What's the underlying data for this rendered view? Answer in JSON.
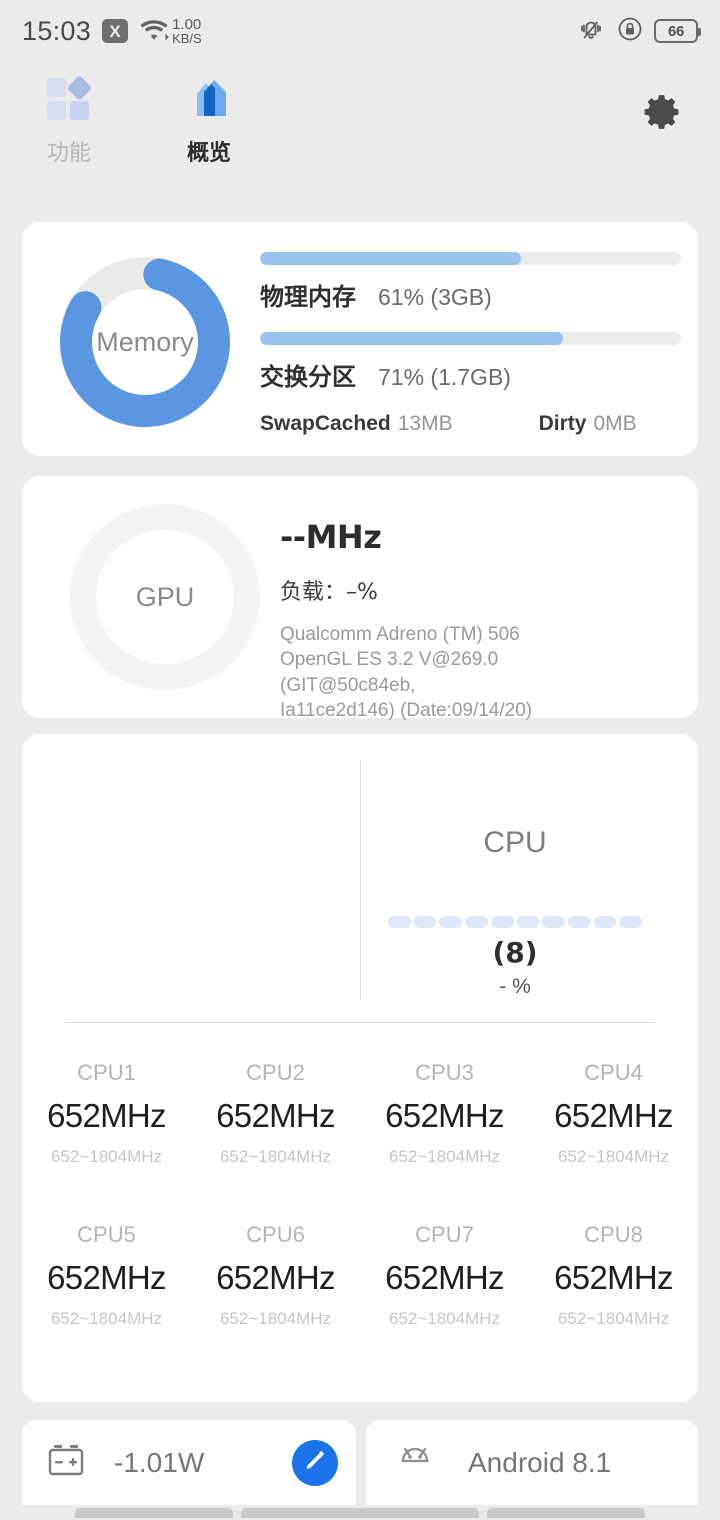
{
  "statusbar": {
    "time": "15:03",
    "x_badge": "X",
    "net_speed_value": "1.00",
    "net_speed_unit": "KB/S",
    "wifi_icon": "wifi-icon",
    "mute_icon": "bell-muted-icon",
    "rotation_lock_icon": "rotation-lock-icon",
    "battery_level": "66"
  },
  "tabs": [
    {
      "label": "功能",
      "icon": "grid-diamond-icon",
      "active": false
    },
    {
      "label": "概览",
      "icon": "home-icon",
      "active": true
    }
  ],
  "settings_button": {
    "icon": "gear-icon"
  },
  "memory": {
    "ring_label": "Memory",
    "ring_percent": 80,
    "ring_color": "#5b96e3",
    "ring_track_color": "#eaeaea",
    "rows": [
      {
        "name": "物理内存",
        "value": "61% (3GB)",
        "percent": 62
      },
      {
        "name": "交换分区",
        "value": "71% (1.7GB)",
        "percent": 72
      }
    ],
    "sub": [
      {
        "key": "SwapCached",
        "value": "13MB"
      },
      {
        "key": "Dirty",
        "value": "0MB"
      }
    ],
    "bar_color": "#9bc3f0"
  },
  "gpu": {
    "ring_label": "GPU",
    "frequency": "--MHz",
    "load": "负载：–%",
    "info_lines": [
      "Qualcomm Adreno (TM) 506",
      "OpenGL ES 3.2 V@269.0 (GIT@50c84eb,",
      "Ia11ce2d146) (Date:09/14/20)"
    ]
  },
  "cpu": {
    "title": "CPU",
    "segment_count": 10,
    "segment_color": "#dde9f8",
    "core_count_label": "(8)",
    "usage_label": "- %",
    "cores": [
      {
        "name": "CPU1",
        "freq": "652MHz",
        "range": "652~1804MHz"
      },
      {
        "name": "CPU2",
        "freq": "652MHz",
        "range": "652~1804MHz"
      },
      {
        "name": "CPU3",
        "freq": "652MHz",
        "range": "652~1804MHz"
      },
      {
        "name": "CPU4",
        "freq": "652MHz",
        "range": "652~1804MHz"
      },
      {
        "name": "CPU5",
        "freq": "652MHz",
        "range": "652~1804MHz"
      },
      {
        "name": "CPU6",
        "freq": "652MHz",
        "range": "652~1804MHz"
      },
      {
        "name": "CPU7",
        "freq": "652MHz",
        "range": "652~1804MHz"
      },
      {
        "name": "CPU8",
        "freq": "652MHz",
        "range": "652~1804MHz"
      }
    ]
  },
  "bottom": {
    "battery_power": "-1.01W",
    "battery_icon": "battery-icon",
    "edit_icon": "pencil-icon",
    "android_icon": "android-robot-icon",
    "android_version": "Android 8.1",
    "fab_color": "#1a73e8"
  }
}
